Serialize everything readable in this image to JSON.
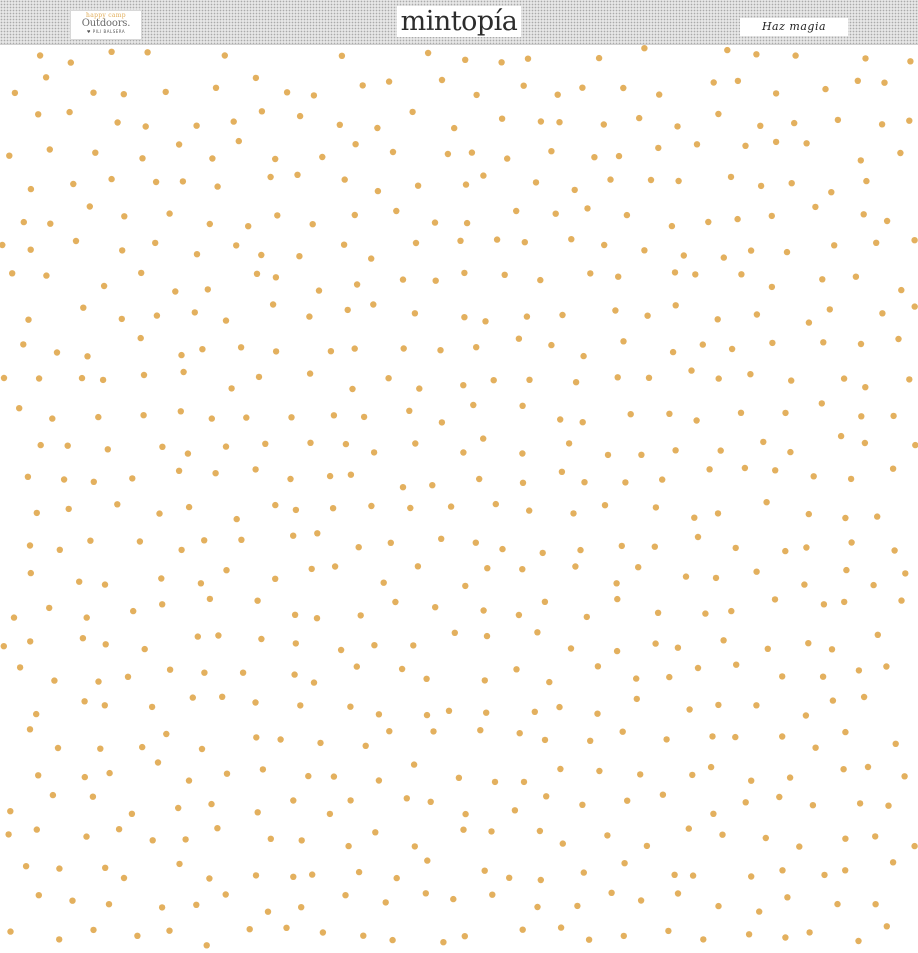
{
  "header": {
    "collection_tagline": "happy camp",
    "collection_name": "Outdoors.",
    "collection_author": "♥ PILI BALSERA",
    "brand_name": "mintopía",
    "slogan": "Haz magia"
  },
  "pattern": {
    "type": "polka-dot",
    "background_color": "#ffffff",
    "dot_color": "#e3b05e"
  }
}
